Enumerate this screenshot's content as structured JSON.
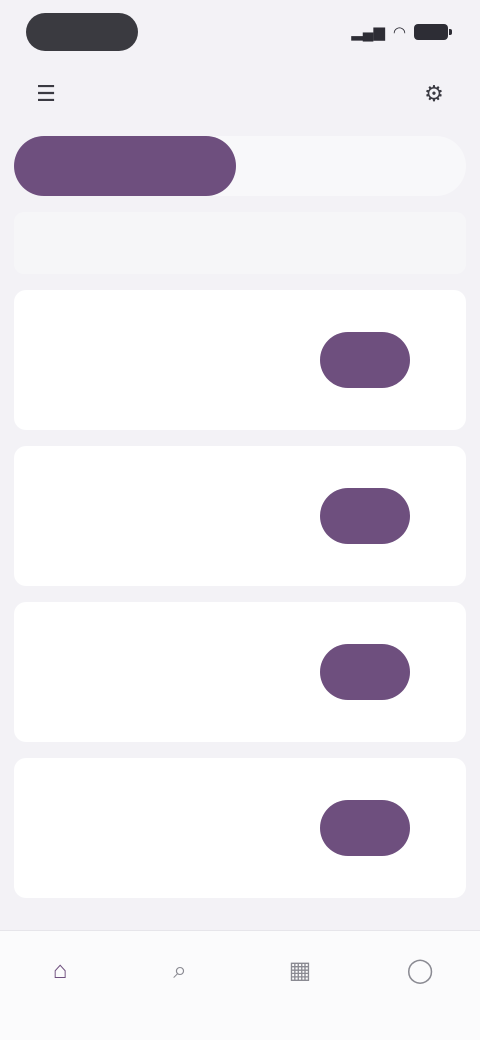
{
  "status_bar": {
    "time": "",
    "signal_glyph": "▂▄▆",
    "wifi_glyph": "◠"
  },
  "header": {
    "title": "",
    "menu_icon": "menu-icon",
    "profile_icon": "settings-icon"
  },
  "segments": [
    {
      "label": "",
      "active": true
    },
    {
      "label": "",
      "active": false
    }
  ],
  "section_heading": "",
  "cards": [
    {
      "title": "",
      "line1": "",
      "line2": "",
      "action": ""
    },
    {
      "title": "",
      "line1": "",
      "line2": "",
      "action": ""
    },
    {
      "title": "",
      "line1": "",
      "line2": "",
      "action": ""
    },
    {
      "title": "",
      "line1": "",
      "line2": "",
      "action": ""
    }
  ],
  "bottom_nav": [
    {
      "label": "",
      "icon": "home-icon",
      "glyph": "⌂",
      "active": true
    },
    {
      "label": "",
      "icon": "search-icon",
      "glyph": "⌕",
      "active": false
    },
    {
      "label": "",
      "icon": "calendar-icon",
      "glyph": "▦",
      "active": false
    },
    {
      "label": "",
      "icon": "profile-icon",
      "glyph": "◯",
      "active": false
    }
  ],
  "colors": {
    "accent": "#6e4f7e",
    "background": "#f3f2f6",
    "card": "#ffffff"
  }
}
